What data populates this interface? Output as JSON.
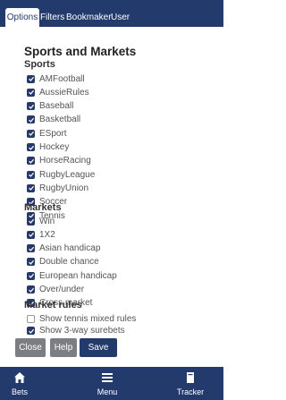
{
  "tabs": [
    {
      "label": "Options",
      "active": true
    },
    {
      "label": "Filters",
      "active": false
    },
    {
      "label": "Bookmaker",
      "active": false
    },
    {
      "label": "User",
      "active": false
    }
  ],
  "title": "Sports and Markets",
  "sections": {
    "sports": "Sports",
    "markets": "Markets",
    "rules": "Market rules"
  },
  "sports": [
    {
      "label": "AMFootball",
      "checked": true
    },
    {
      "label": "AussieRules",
      "checked": true
    },
    {
      "label": "Baseball",
      "checked": true
    },
    {
      "label": "Basketball",
      "checked": true
    },
    {
      "label": "ESport",
      "checked": true
    },
    {
      "label": "Hockey",
      "checked": true
    },
    {
      "label": "HorseRacing",
      "checked": true
    },
    {
      "label": "RugbyLeague",
      "checked": true
    },
    {
      "label": "RugbyUnion",
      "checked": true
    },
    {
      "label": "Soccer",
      "checked": true
    },
    {
      "label": "Tennis",
      "checked": true
    }
  ],
  "markets": [
    {
      "label": "Win",
      "checked": true
    },
    {
      "label": "1X2",
      "checked": true
    },
    {
      "label": "Asian handicap",
      "checked": true
    },
    {
      "label": "Double chance",
      "checked": true
    },
    {
      "label": "European handicap",
      "checked": true
    },
    {
      "label": "Over/under",
      "checked": true
    },
    {
      "label": "Cross market",
      "checked": true
    }
  ],
  "rules": [
    {
      "label": "Show tennis mixed rules",
      "checked": false
    },
    {
      "label": "Show 3-way surebets",
      "checked": true
    }
  ],
  "buttons": {
    "close": "Close",
    "help": "Help",
    "save": "Save"
  },
  "bottom_nav": {
    "bets": "Bets",
    "menu": "Menu",
    "tracker": "Tracker"
  },
  "colors": {
    "nav_bg": "#223a6c",
    "checkbox": "#26396a",
    "secondary_button": "#7b7e82"
  }
}
